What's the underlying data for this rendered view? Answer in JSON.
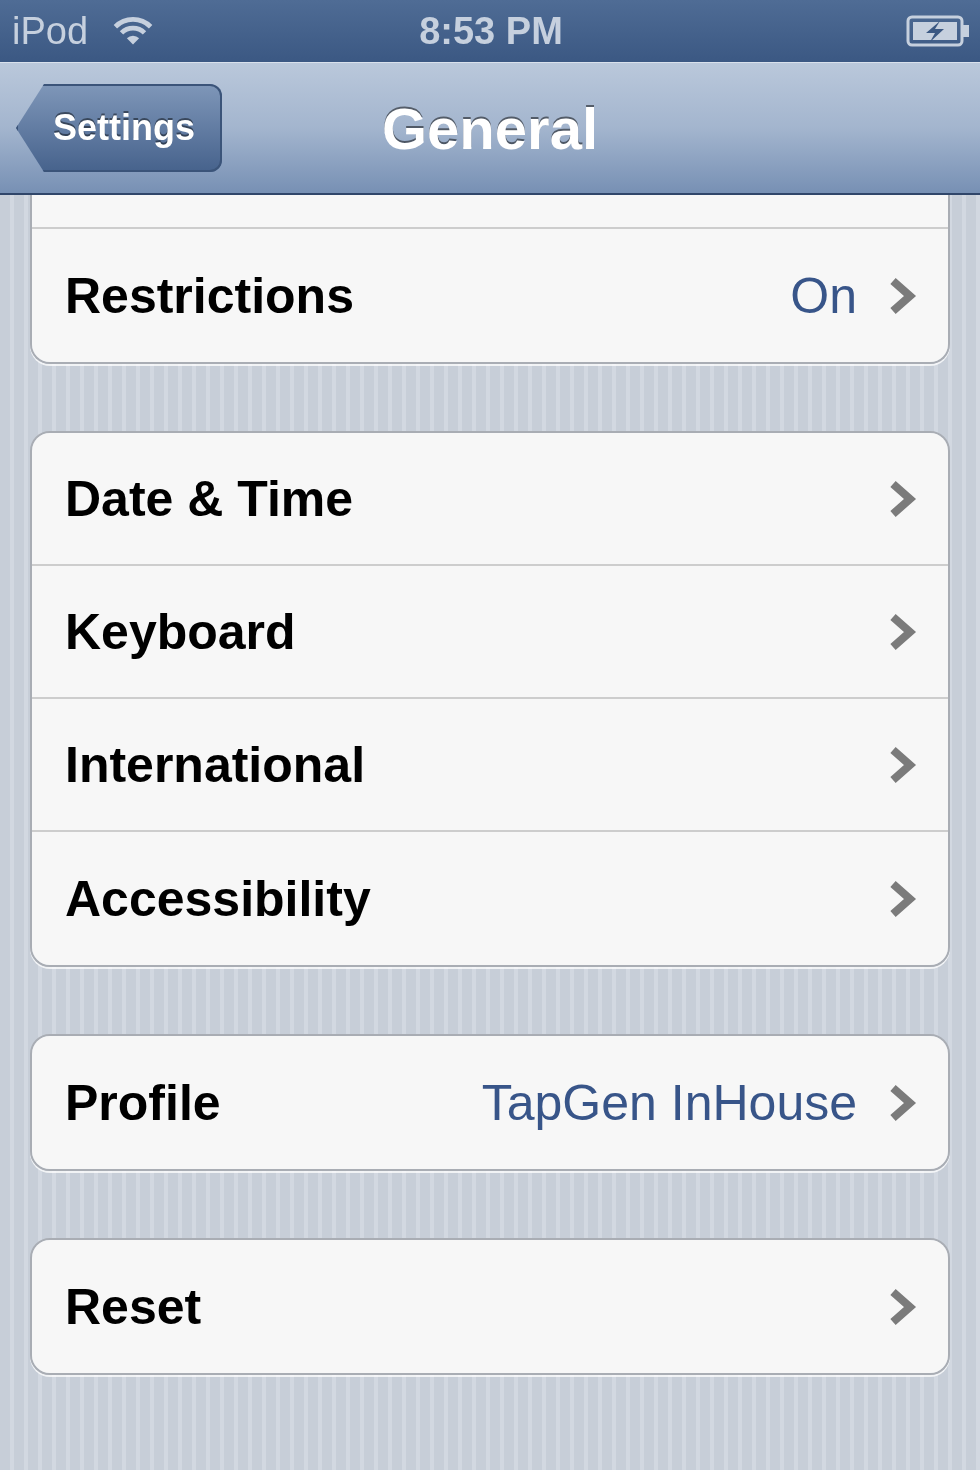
{
  "status_bar": {
    "carrier": "iPod",
    "time": "8:53 PM"
  },
  "nav_bar": {
    "back_button": "Settings",
    "title": "General"
  },
  "groups": [
    {
      "cut_off_top": true,
      "rows": [
        {
          "label": "Restrictions",
          "value": "On"
        }
      ]
    },
    {
      "cut_off_top": false,
      "rows": [
        {
          "label": "Date & Time"
        },
        {
          "label": "Keyboard"
        },
        {
          "label": "International"
        },
        {
          "label": "Accessibility"
        }
      ]
    },
    {
      "cut_off_top": false,
      "rows": [
        {
          "label": "Profile",
          "value": "TapGen InHouse"
        }
      ]
    },
    {
      "cut_off_top": false,
      "rows": [
        {
          "label": "Reset"
        }
      ]
    }
  ]
}
